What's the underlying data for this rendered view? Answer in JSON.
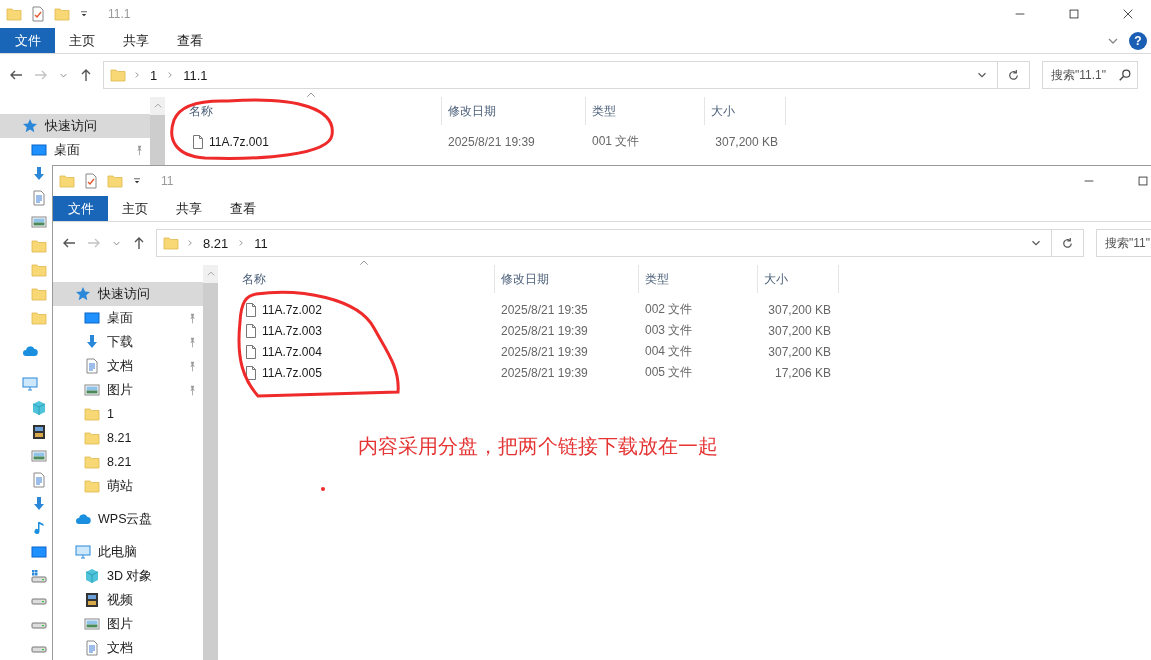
{
  "windows": [
    {
      "title": "11.1",
      "ribbon_tabs": [
        {
          "label": "文件",
          "kind": "file-menu"
        },
        {
          "label": "主页",
          "kind": "tab"
        },
        {
          "label": "共享",
          "kind": "tab"
        },
        {
          "label": "查看",
          "kind": "tab"
        }
      ],
      "help": "?",
      "forward_enabled": false,
      "path": [
        "1",
        "11.1"
      ],
      "search": {
        "placeholder": "搜索\"11.1\""
      },
      "columns": [
        "名称",
        "修改日期",
        "类型",
        "大小"
      ],
      "rows": [
        {
          "name": "11A.7z.001",
          "modified": "2025/8/21 19:39",
          "type": "001 文件",
          "size": "307,200 KB"
        }
      ],
      "sidebar": [
        {
          "label": "快速访问",
          "kind": "star",
          "selected": true,
          "children": [
            {
              "label": "桌面",
              "kind": "desktop",
              "pinned": true,
              "selected": false
            },
            {
              "kind": "download"
            },
            {
              "kind": "document"
            },
            {
              "kind": "picture"
            },
            {
              "kind": "folder"
            },
            {
              "kind": "folder"
            },
            {
              "kind": "folder"
            },
            {
              "kind": "folder"
            }
          ]
        },
        {
          "kind": "cloud"
        },
        {
          "kind": "pc",
          "children": [
            {
              "kind": "cube"
            },
            {
              "kind": "video"
            },
            {
              "kind": "picture"
            },
            {
              "kind": "document"
            },
            {
              "kind": "download"
            },
            {
              "kind": "music"
            },
            {
              "kind": "desktop"
            },
            {
              "kind": "drivewin"
            },
            {
              "kind": "drive"
            },
            {
              "kind": "drive"
            },
            {
              "kind": "drive"
            }
          ]
        }
      ]
    },
    {
      "title": "11",
      "ribbon_tabs": [
        {
          "label": "文件",
          "kind": "file-menu"
        },
        {
          "label": "主页",
          "kind": "tab"
        },
        {
          "label": "共享",
          "kind": "tab"
        },
        {
          "label": "查看",
          "kind": "tab"
        }
      ],
      "forward_enabled": false,
      "path": [
        "8.21",
        "11"
      ],
      "search": {
        "placeholder": "搜索\"11\""
      },
      "columns": [
        "名称",
        "修改日期",
        "类型",
        "大小"
      ],
      "rows": [
        {
          "name": "11A.7z.002",
          "modified": "2025/8/21 19:35",
          "type": "002 文件",
          "size": "307,200 KB"
        },
        {
          "name": "11A.7z.003",
          "modified": "2025/8/21 19:39",
          "type": "003 文件",
          "size": "307,200 KB"
        },
        {
          "name": "11A.7z.004",
          "modified": "2025/8/21 19:39",
          "type": "004 文件",
          "size": "307,200 KB"
        },
        {
          "name": "11A.7z.005",
          "modified": "2025/8/21 19:39",
          "type": "005 文件",
          "size": "17,206 KB"
        }
      ],
      "sidebar": [
        {
          "label": "快速访问",
          "kind": "star",
          "selected": true,
          "children": [
            {
              "label": "桌面",
              "kind": "desktop",
              "pinned": true,
              "selected": false
            },
            {
              "label": "下载",
              "kind": "download",
              "pinned": true,
              "selected": false
            },
            {
              "label": "文档",
              "kind": "document",
              "pinned": true,
              "selected": false
            },
            {
              "label": "图片",
              "kind": "picture",
              "pinned": true,
              "selected": false
            },
            {
              "label": "1",
              "kind": "folder",
              "pinned": false,
              "selected": false
            },
            {
              "label": "8.21",
              "kind": "folder",
              "pinned": false,
              "selected": false
            },
            {
              "label": "8.21",
              "kind": "folder",
              "pinned": false,
              "selected": false
            },
            {
              "label": "萌站",
              "kind": "folder",
              "pinned": false,
              "selected": false
            }
          ]
        },
        {
          "label": "WPS云盘",
          "kind": "cloud",
          "selected": false
        },
        {
          "label": "此电脑",
          "kind": "pc",
          "selected": false,
          "children": [
            {
              "label": "3D 对象",
              "kind": "cube",
              "selected": false
            },
            {
              "label": "视频",
              "kind": "video",
              "selected": false
            },
            {
              "label": "图片",
              "kind": "picture",
              "selected": false
            },
            {
              "label": "文档",
              "kind": "document",
              "selected": false
            }
          ]
        }
      ]
    }
  ],
  "annotation": {
    "note": "内容采用分盘，把两个链接下载放在一起"
  }
}
